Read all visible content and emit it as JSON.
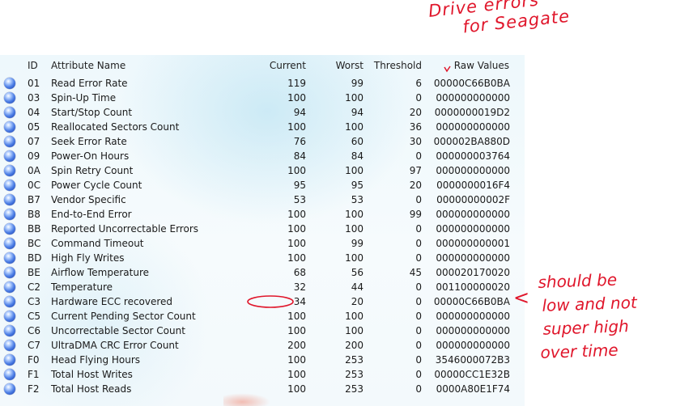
{
  "table": {
    "headers": {
      "id": "ID",
      "name": "Attribute Name",
      "current": "Current",
      "worst": "Worst",
      "threshold": "Threshold",
      "raw": "Raw Values"
    },
    "rows": [
      {
        "id": "01",
        "name": "Read Error Rate",
        "current": "119",
        "worst": "99",
        "threshold": "6",
        "raw": "00000C66B0BA"
      },
      {
        "id": "03",
        "name": "Spin-Up Time",
        "current": "100",
        "worst": "100",
        "threshold": "0",
        "raw": "000000000000"
      },
      {
        "id": "04",
        "name": "Start/Stop Count",
        "current": "94",
        "worst": "94",
        "threshold": "20",
        "raw": "0000000019D2"
      },
      {
        "id": "05",
        "name": "Reallocated Sectors Count",
        "current": "100",
        "worst": "100",
        "threshold": "36",
        "raw": "000000000000"
      },
      {
        "id": "07",
        "name": "Seek Error Rate",
        "current": "76",
        "worst": "60",
        "threshold": "30",
        "raw": "000002BA880D"
      },
      {
        "id": "09",
        "name": "Power-On Hours",
        "current": "84",
        "worst": "84",
        "threshold": "0",
        "raw": "000000003764"
      },
      {
        "id": "0A",
        "name": "Spin Retry Count",
        "current": "100",
        "worst": "100",
        "threshold": "97",
        "raw": "000000000000"
      },
      {
        "id": "0C",
        "name": "Power Cycle Count",
        "current": "95",
        "worst": "95",
        "threshold": "20",
        "raw": "0000000016F4"
      },
      {
        "id": "B7",
        "name": "Vendor Specific",
        "current": "53",
        "worst": "53",
        "threshold": "0",
        "raw": "00000000002F"
      },
      {
        "id": "B8",
        "name": "End-to-End Error",
        "current": "100",
        "worst": "100",
        "threshold": "99",
        "raw": "000000000000"
      },
      {
        "id": "BB",
        "name": "Reported Uncorrectable Errors",
        "current": "100",
        "worst": "100",
        "threshold": "0",
        "raw": "000000000000"
      },
      {
        "id": "BC",
        "name": "Command Timeout",
        "current": "100",
        "worst": "99",
        "threshold": "0",
        "raw": "000000000001"
      },
      {
        "id": "BD",
        "name": "High Fly Writes",
        "current": "100",
        "worst": "100",
        "threshold": "0",
        "raw": "000000000000"
      },
      {
        "id": "BE",
        "name": "Airflow Temperature",
        "current": "68",
        "worst": "56",
        "threshold": "45",
        "raw": "000020170020"
      },
      {
        "id": "C2",
        "name": "Temperature",
        "current": "32",
        "worst": "44",
        "threshold": "0",
        "raw": "001100000020"
      },
      {
        "id": "C3",
        "name": "Hardware ECC recovered",
        "current": "34",
        "worst": "20",
        "threshold": "0",
        "raw": "00000C66B0BA"
      },
      {
        "id": "C5",
        "name": "Current Pending Sector Count",
        "current": "100",
        "worst": "100",
        "threshold": "0",
        "raw": "000000000000"
      },
      {
        "id": "C6",
        "name": "Uncorrectable Sector Count",
        "current": "100",
        "worst": "100",
        "threshold": "0",
        "raw": "000000000000"
      },
      {
        "id": "C7",
        "name": "UltraDMA CRC Error Count",
        "current": "200",
        "worst": "200",
        "threshold": "0",
        "raw": "000000000000"
      },
      {
        "id": "F0",
        "name": "Head Flying Hours",
        "current": "100",
        "worst": "253",
        "threshold": "0",
        "raw": "3546000072B3"
      },
      {
        "id": "F1",
        "name": "Total Host Writes",
        "current": "100",
        "worst": "253",
        "threshold": "0",
        "raw": "00000CC1E32B"
      },
      {
        "id": "F2",
        "name": "Total Host Reads",
        "current": "100",
        "worst": "253",
        "threshold": "0",
        "raw": "0000A80E1F74"
      }
    ]
  },
  "annotations": {
    "title_lines": [
      "Drive errors",
      "for Seagate"
    ],
    "note_lines": [
      "should be",
      "low and not",
      "super high",
      "over time"
    ],
    "arrow_glyph": "<",
    "ink_color": "#e0162b"
  },
  "colors": {
    "status_dot": "#3a6fde",
    "table_bg": "#eef8fc"
  }
}
